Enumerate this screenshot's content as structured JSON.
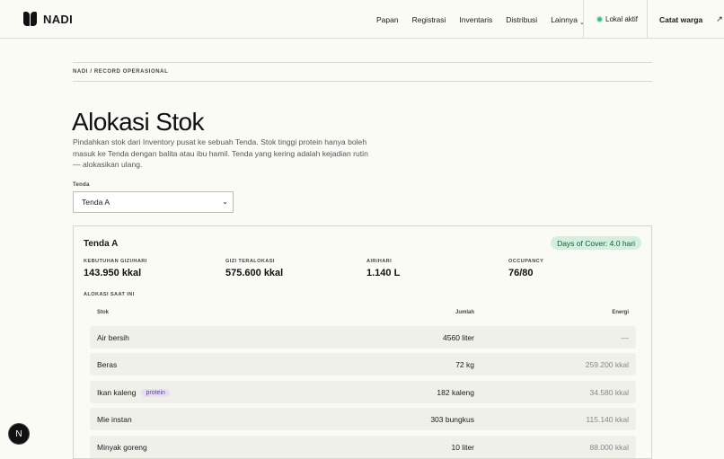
{
  "brand": {
    "name": "NADI"
  },
  "nav": {
    "items": [
      {
        "label": "Papan"
      },
      {
        "label": "Registrasi"
      },
      {
        "label": "Inventaris"
      },
      {
        "label": "Distribusi"
      },
      {
        "label": "Lainnya"
      }
    ],
    "status": "Lokal aktif",
    "cta": "Catat warga"
  },
  "breadcrumb": "NADI / RECORD OPERASIONAL",
  "page": {
    "title": "Alokasi Stok",
    "description": "Pindahkan stok dari Inventory pusat ke sebuah Tenda. Stok tinggi protein hanya boleh masuk ke Tenda dengan balita atau ibu hamil. Tenda yang kering adalah kejadian rutin — alokasikan ulang."
  },
  "tenda_select": {
    "label": "Tenda",
    "value": "Tenda A"
  },
  "card": {
    "title": "Tenda A",
    "badge": "Days of Cover: 4.0 hari",
    "metrics": [
      {
        "label": "KEBUTUHAN GIZI/HARI",
        "value": "143.950 kkal"
      },
      {
        "label": "GIZI TERALOKASI",
        "value": "575.600 kkal"
      },
      {
        "label": "AIR/HARI",
        "value": "1.140 L"
      },
      {
        "label": "OCCUPANCY",
        "value": "76/80"
      }
    ],
    "section_label": "ALOKASI SAAT INI",
    "columns": {
      "stok": "Stok",
      "jumlah": "Jumlah",
      "energi": "Energi"
    },
    "rows": [
      {
        "stok": "Air bersih",
        "tag": "",
        "jumlah": "4560 liter",
        "energi": "—"
      },
      {
        "stok": "Beras",
        "tag": "",
        "jumlah": "72 kg",
        "energi": "259.200 kkal"
      },
      {
        "stok": "Ikan kaleng",
        "tag": "protein",
        "jumlah": "182 kaleng",
        "energi": "34.580 kkal"
      },
      {
        "stok": "Mie instan",
        "tag": "",
        "jumlah": "303 bungkus",
        "energi": "115.140 kkal"
      },
      {
        "stok": "Minyak goreng",
        "tag": "",
        "jumlah": "10 liter",
        "energi": "88.000 kkal"
      }
    ]
  },
  "fab": {
    "label": "N"
  }
}
